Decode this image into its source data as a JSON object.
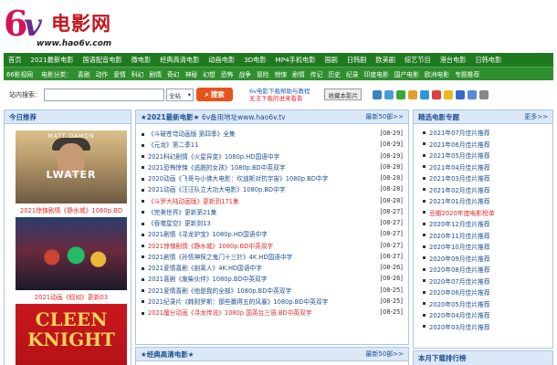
{
  "logo": {
    "six": "6",
    "v": "v",
    "cn": "电影网",
    "url": "www.hao6v.com"
  },
  "nav1": [
    "首页",
    "2021最新电影",
    "国语配音电影",
    "微电影",
    "经典高清电影",
    "动画电影",
    "3D电影",
    "MP4手机电影",
    "国剧",
    "日韩剧",
    "欧美剧",
    "综艺节目",
    "港台电影",
    "日韩电影"
  ],
  "nav2": [
    "66影视网",
    "电影分类：",
    "喜剧",
    "动作",
    "爱情",
    "科幻",
    "剧情",
    "奇幻",
    "神秘",
    "幻想",
    "恐怖",
    "战争",
    "冒险",
    "惊悚",
    "剧情",
    "传记",
    "历史",
    "纪录",
    "印度电影",
    "国产电影",
    "欧洲电影",
    "专题推荐"
  ],
  "search": {
    "label": "站内搜索：",
    "placeholder": "",
    "select_value": "全站",
    "button": "搜索",
    "tip1": "6v电影下载帮助与教程",
    "tip2": "无法下载的进来看看",
    "fav": "收藏本影片"
  },
  "left": {
    "title": "今日推荐",
    "posters": [
      {
        "star": "MATT DAMON",
        "title": "LWATER",
        "caption": "2021惊悚剧情《静水城》1080p.BD"
      },
      {
        "star": "",
        "title": "",
        "caption": "2021动画《假如》更新03"
      },
      {
        "star": "",
        "title": "CLEEN KNIGHT",
        "caption": ""
      }
    ]
  },
  "mid": {
    "title": "★2021最新电影★",
    "link": "6v备用地址www.hao6v.tv",
    "more": "最新50部>>",
    "items": [
      {
        "text": "《斗破苍穹动画版 第四季》全集",
        "date": "[08-29]",
        "red": false
      },
      {
        "text": "《元龙》第二季11",
        "date": "[08-29]",
        "red": false
      },
      {
        "text": "2021科幻剧情《火星异变》1080p.HD国语中字",
        "date": "[08-29]",
        "red": false
      },
      {
        "text": "2021恐怖惊悚《逃脱的女孩》1080p.BD中英双字",
        "date": "[08-28]",
        "red": false
      },
      {
        "text": "2020动画《飞哥与小佛大电影：坎迪斯对抗宇宙》1080p.BD中字",
        "date": "[08-28]",
        "red": false
      },
      {
        "text": "2021动画《汪汪队立大功大电影》1080p.BD中字",
        "date": "[08-28]",
        "red": false
      },
      {
        "text": "《斗罗大陆动画版》更新到171集",
        "date": "[08-28]",
        "red": true
      },
      {
        "text": "《完美世界》更新第21集",
        "date": "[08-27]",
        "red": false
      },
      {
        "text": "《吞噬星空》更新到13",
        "date": "[08-27]",
        "red": false
      },
      {
        "text": "2021剧情《寻龙护宝》1080p.HD国语中字",
        "date": "[08-27]",
        "red": false
      },
      {
        "text": "2021惊悚剧情《静水城》1080p.BD中英双字",
        "date": "[08-27]",
        "red": true
      },
      {
        "text": "2021剧情《孙悟神探之鬼门十三针》4K.HD国语中字",
        "date": "[08-27]",
        "red": false
      },
      {
        "text": "2021爱情喜剧《剖离人》4K.HD国语中字",
        "date": "[08-26]",
        "red": false
      },
      {
        "text": "2021喜剧《废柴伙伴》1080p.BD中英双字",
        "date": "[08-26]",
        "red": false
      },
      {
        "text": "2021爱情喜剧《他是我的全部》1080p.BD中英双字",
        "date": "[08-25]",
        "red": false
      },
      {
        "text": "2021纪录片《韩则罗斯：那些赢得五的风暴》1080p.BD中英双字",
        "date": "[08-25]",
        "red": false
      },
      {
        "text": "2021魔分动画《寻龙传说》1080p 国英台三语.BD中英双字",
        "date": "[08-25]",
        "red": true
      }
    ],
    "second_title": "★经典高清电影★",
    "second_more": "最新50部>>"
  },
  "right": {
    "title": "精选电影专题",
    "more": "更多>>",
    "items": [
      {
        "text": "2021年07月佳片推荐",
        "red": false
      },
      {
        "text": "2021年06月佳片推荐",
        "red": false
      },
      {
        "text": "2021年05月佳片推荐",
        "red": false
      },
      {
        "text": "2021年04月佳片推荐",
        "red": false
      },
      {
        "text": "2021年03月佳片推荐",
        "red": false
      },
      {
        "text": "2021年02月佳片推荐",
        "red": false
      },
      {
        "text": "2021年01月佳片推荐",
        "red": false
      },
      {
        "text": "豆瓣2020年度电影榜单",
        "red": true
      },
      {
        "text": "2020年12月佳片推荐",
        "red": false
      },
      {
        "text": "2020年11月佳片推荐",
        "red": false
      },
      {
        "text": "2020年10月佳片推荐",
        "red": false
      },
      {
        "text": "2020年09月佳片推荐",
        "red": false
      },
      {
        "text": "2020年08月佳片推荐",
        "red": false
      },
      {
        "text": "2020年07月佳片推荐",
        "red": false
      },
      {
        "text": "2020年06月佳片推荐",
        "red": false
      },
      {
        "text": "2020年05月佳片推荐",
        "red": false
      },
      {
        "text": "2020年04月佳片推荐",
        "red": false
      },
      {
        "text": "2020年03月佳片推荐",
        "red": false
      }
    ],
    "second_title": "本月下载排行榜"
  },
  "colors": {
    "nav": "#1f7a1f",
    "accent_red": "#e52b2b",
    "link_blue": "#1b4f91",
    "head_bg": "#dbe8f7"
  }
}
